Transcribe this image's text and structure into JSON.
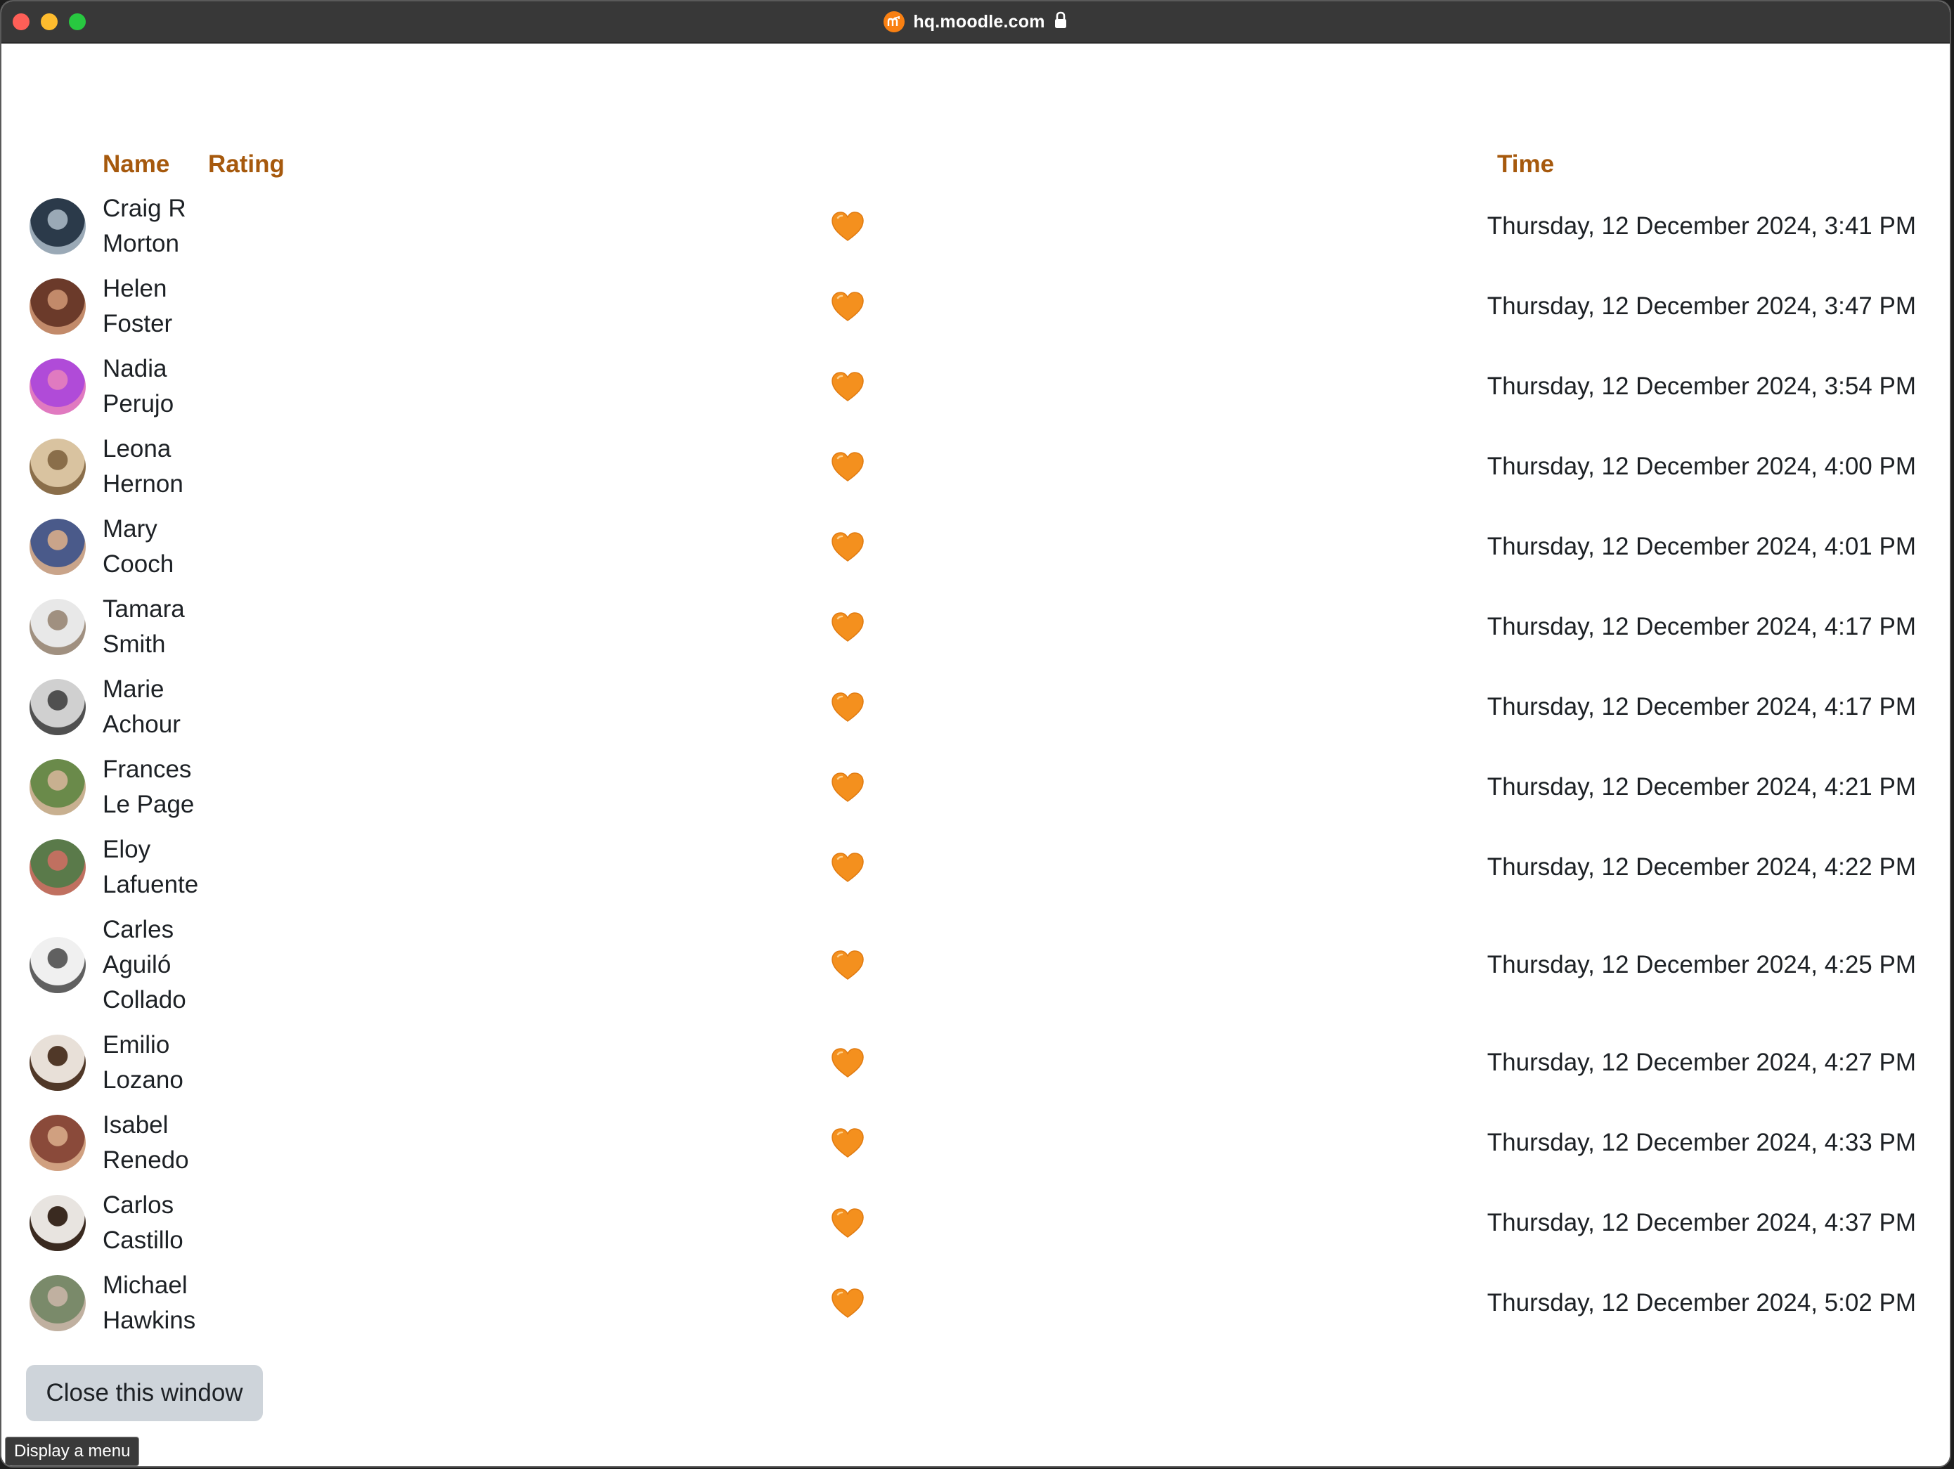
{
  "browser": {
    "url": "hq.moodle.com"
  },
  "table": {
    "headers": {
      "name": "Name",
      "rating": "Rating",
      "time": "Time"
    },
    "rows": [
      {
        "name_lines": [
          "Craig R",
          "Morton"
        ],
        "rating": "orange-heart-icon",
        "time": "Thursday, 12 December 2024, 3:41 PM"
      },
      {
        "name_lines": [
          "Helen",
          "Foster"
        ],
        "rating": "orange-heart-icon",
        "time": "Thursday, 12 December 2024, 3:47 PM"
      },
      {
        "name_lines": [
          "Nadia",
          "Perujo"
        ],
        "rating": "orange-heart-icon",
        "time": "Thursday, 12 December 2024, 3:54 PM"
      },
      {
        "name_lines": [
          "Leona",
          "Hernon"
        ],
        "rating": "orange-heart-icon",
        "time": "Thursday, 12 December 2024, 4:00 PM"
      },
      {
        "name_lines": [
          "Mary",
          "Cooch"
        ],
        "rating": "orange-heart-icon",
        "time": "Thursday, 12 December 2024, 4:01 PM"
      },
      {
        "name_lines": [
          "Tamara",
          "Smith"
        ],
        "rating": "orange-heart-icon",
        "time": "Thursday, 12 December 2024, 4:17 PM"
      },
      {
        "name_lines": [
          "Marie",
          "Achour"
        ],
        "rating": "orange-heart-icon",
        "time": "Thursday, 12 December 2024, 4:17 PM"
      },
      {
        "name_lines": [
          "Frances",
          "Le Page"
        ],
        "rating": "orange-heart-icon",
        "time": "Thursday, 12 December 2024, 4:21 PM"
      },
      {
        "name_lines": [
          "Eloy",
          "Lafuente"
        ],
        "rating": "orange-heart-icon",
        "time": "Thursday, 12 December 2024, 4:22 PM"
      },
      {
        "name_lines": [
          "Carles",
          "Aguiló",
          "Collado"
        ],
        "rating": "orange-heart-icon",
        "time": "Thursday, 12 December 2024, 4:25 PM"
      },
      {
        "name_lines": [
          "Emilio",
          "Lozano"
        ],
        "rating": "orange-heart-icon",
        "time": "Thursday, 12 December 2024, 4:27 PM"
      },
      {
        "name_lines": [
          "Isabel",
          "Renedo"
        ],
        "rating": "orange-heart-icon",
        "time": "Thursday, 12 December 2024, 4:33 PM"
      },
      {
        "name_lines": [
          "Carlos",
          "Castillo"
        ],
        "rating": "orange-heart-icon",
        "time": "Thursday, 12 December 2024, 4:37 PM"
      },
      {
        "name_lines": [
          "Michael",
          "Hawkins"
        ],
        "rating": "orange-heart-icon",
        "time": "Thursday, 12 December 2024, 5:02 PM"
      }
    ]
  },
  "actions": {
    "close_label": "Close this window"
  },
  "tooltip": {
    "text": "Display a menu"
  },
  "colors": {
    "header_accent": "#a6590d",
    "heart": "#f4901e",
    "button_bg": "#ced4da"
  }
}
